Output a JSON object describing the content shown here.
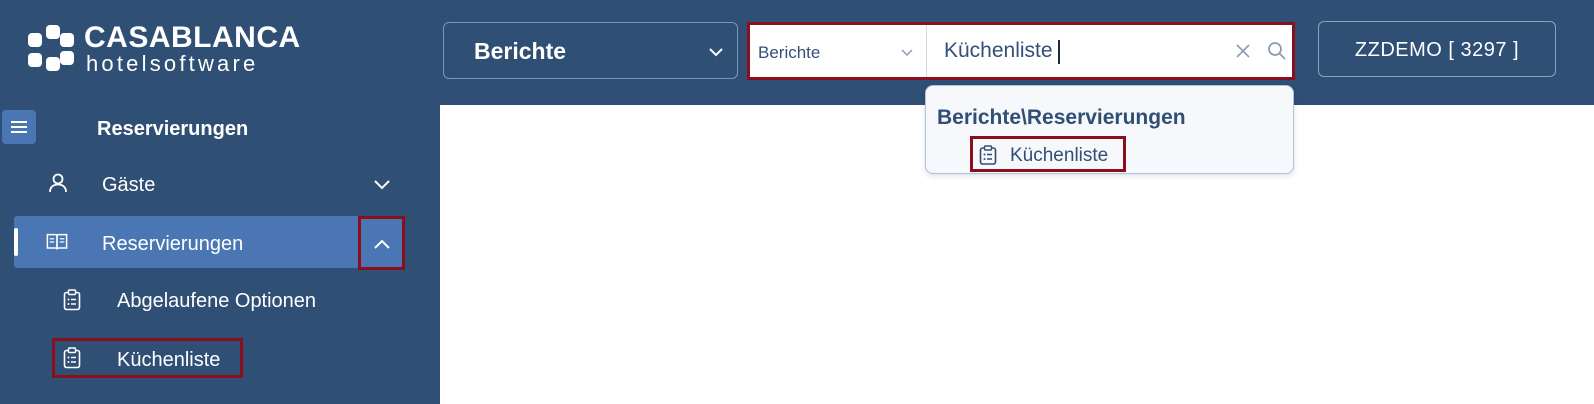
{
  "brand": {
    "title": "CASABLANCA",
    "subtitle": "hotelsoftware"
  },
  "header": {
    "module_select": {
      "selected": "Berichte"
    },
    "search": {
      "scope": "Berichte",
      "value": "Küchenliste"
    },
    "user_button": "ZZDEMO  [ 3297 ]"
  },
  "search_results": {
    "group": "Berichte\\Reservierungen",
    "items": [
      {
        "label": "Küchenliste",
        "icon": "clipboard-list-icon"
      }
    ]
  },
  "sidebar": {
    "section_title": "Reservierungen",
    "items": [
      {
        "label": "Gäste",
        "icon": "user-icon",
        "expanded": false
      },
      {
        "label": "Reservierungen",
        "icon": "book-icon",
        "expanded": true,
        "active": true
      }
    ],
    "subitems": [
      {
        "label": "Abgelaufene Optionen",
        "icon": "clipboard-list-icon"
      },
      {
        "label": "Küchenliste",
        "icon": "clipboard-list-icon"
      }
    ]
  },
  "colors": {
    "sidebar_bg": "#304f75",
    "active_item_bg": "#4a77b4",
    "highlight_border": "#8b0e1c"
  }
}
